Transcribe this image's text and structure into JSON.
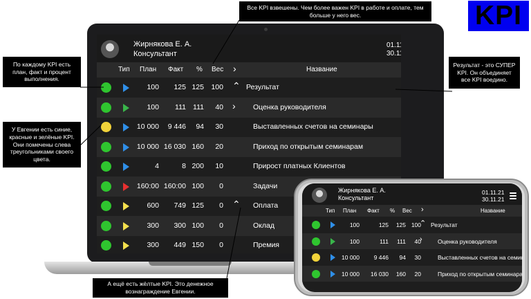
{
  "app": {
    "user_name": "Жирнякова Е. А.",
    "user_role": "Консультант",
    "date_from": "01.11.21",
    "date_to": "30.11.21",
    "columns": {
      "type": "Тип",
      "plan": "План",
      "fact": "Факт",
      "pct": "%",
      "weight": "Вес",
      "chevron": "›",
      "name": "Название"
    },
    "rows": [
      {
        "status": "green",
        "triangle": "blue",
        "plan": "100",
        "fact": "125",
        "pct": "125",
        "weight": "100",
        "chevron": "⌃",
        "name": "Результат"
      },
      {
        "status": "green",
        "triangle": "green",
        "plan": "100",
        "fact": "111",
        "pct": "111",
        "weight": "40",
        "chevron": "›",
        "name": "Оценка руководителя"
      },
      {
        "status": "yellow",
        "triangle": "blue",
        "plan": "10 000",
        "fact": "9 446",
        "pct": "94",
        "weight": "30",
        "chevron": "",
        "name": "Выставленных счетов на семинары"
      },
      {
        "status": "green",
        "triangle": "blue",
        "plan": "10 000",
        "fact": "16 030",
        "pct": "160",
        "weight": "20",
        "chevron": "",
        "name": "Приход по открытым семинарам"
      },
      {
        "status": "green",
        "triangle": "blue",
        "plan": "4",
        "fact": "8",
        "pct": "200",
        "weight": "10",
        "chevron": "",
        "name": "Прирост платных Клиентов"
      },
      {
        "status": "green",
        "triangle": "red",
        "plan": "160:00",
        "fact": "160:00",
        "pct": "100",
        "weight": "0",
        "chevron": "",
        "name": "Задачи"
      },
      {
        "status": "green",
        "triangle": "yellow",
        "plan": "600",
        "fact": "749",
        "pct": "125",
        "weight": "0",
        "chevron": "⌃",
        "name": "Оплата"
      },
      {
        "status": "green",
        "triangle": "yellow",
        "plan": "300",
        "fact": "300",
        "pct": "100",
        "weight": "0",
        "chevron": "",
        "name": "Оклад"
      },
      {
        "status": "green",
        "triangle": "yellow",
        "plan": "300",
        "fact": "449",
        "pct": "150",
        "weight": "0",
        "chevron": "",
        "name": "Премия"
      }
    ]
  },
  "phone_rows": [
    {
      "name": "Результат"
    },
    {
      "name": "Оценка руководителя"
    },
    {
      "name": "Выставленных счетов на семин"
    },
    {
      "name": "Приход по открытым семинарам"
    }
  ],
  "callouts": {
    "top": "Все KPI взвешены. Чем более важен KPI в работе и оплате, тем больше у него вес.",
    "left_top": "По каждому KPI есть план, факт и процент выполнения.",
    "left_mid": "У Евгении есть синие, красные и зелёные KPI. Они помечены слева треугольниками своего цвета.",
    "right": "Результат - это СУПЕР KPI. Он объединяет все KPI воедино.",
    "bottom": "А ещё есть жёлтые KPI. Это денежное вознаграждение Евгении."
  },
  "logo": "KPI",
  "colors": {
    "green": "#2fc52f",
    "yellow": "#f2d33a",
    "blue": "#2f8fe8",
    "red": "#e83030",
    "tri_green": "#39b54a",
    "tri_yellow": "#f4e04d",
    "logo_bg": "#0000f0"
  }
}
